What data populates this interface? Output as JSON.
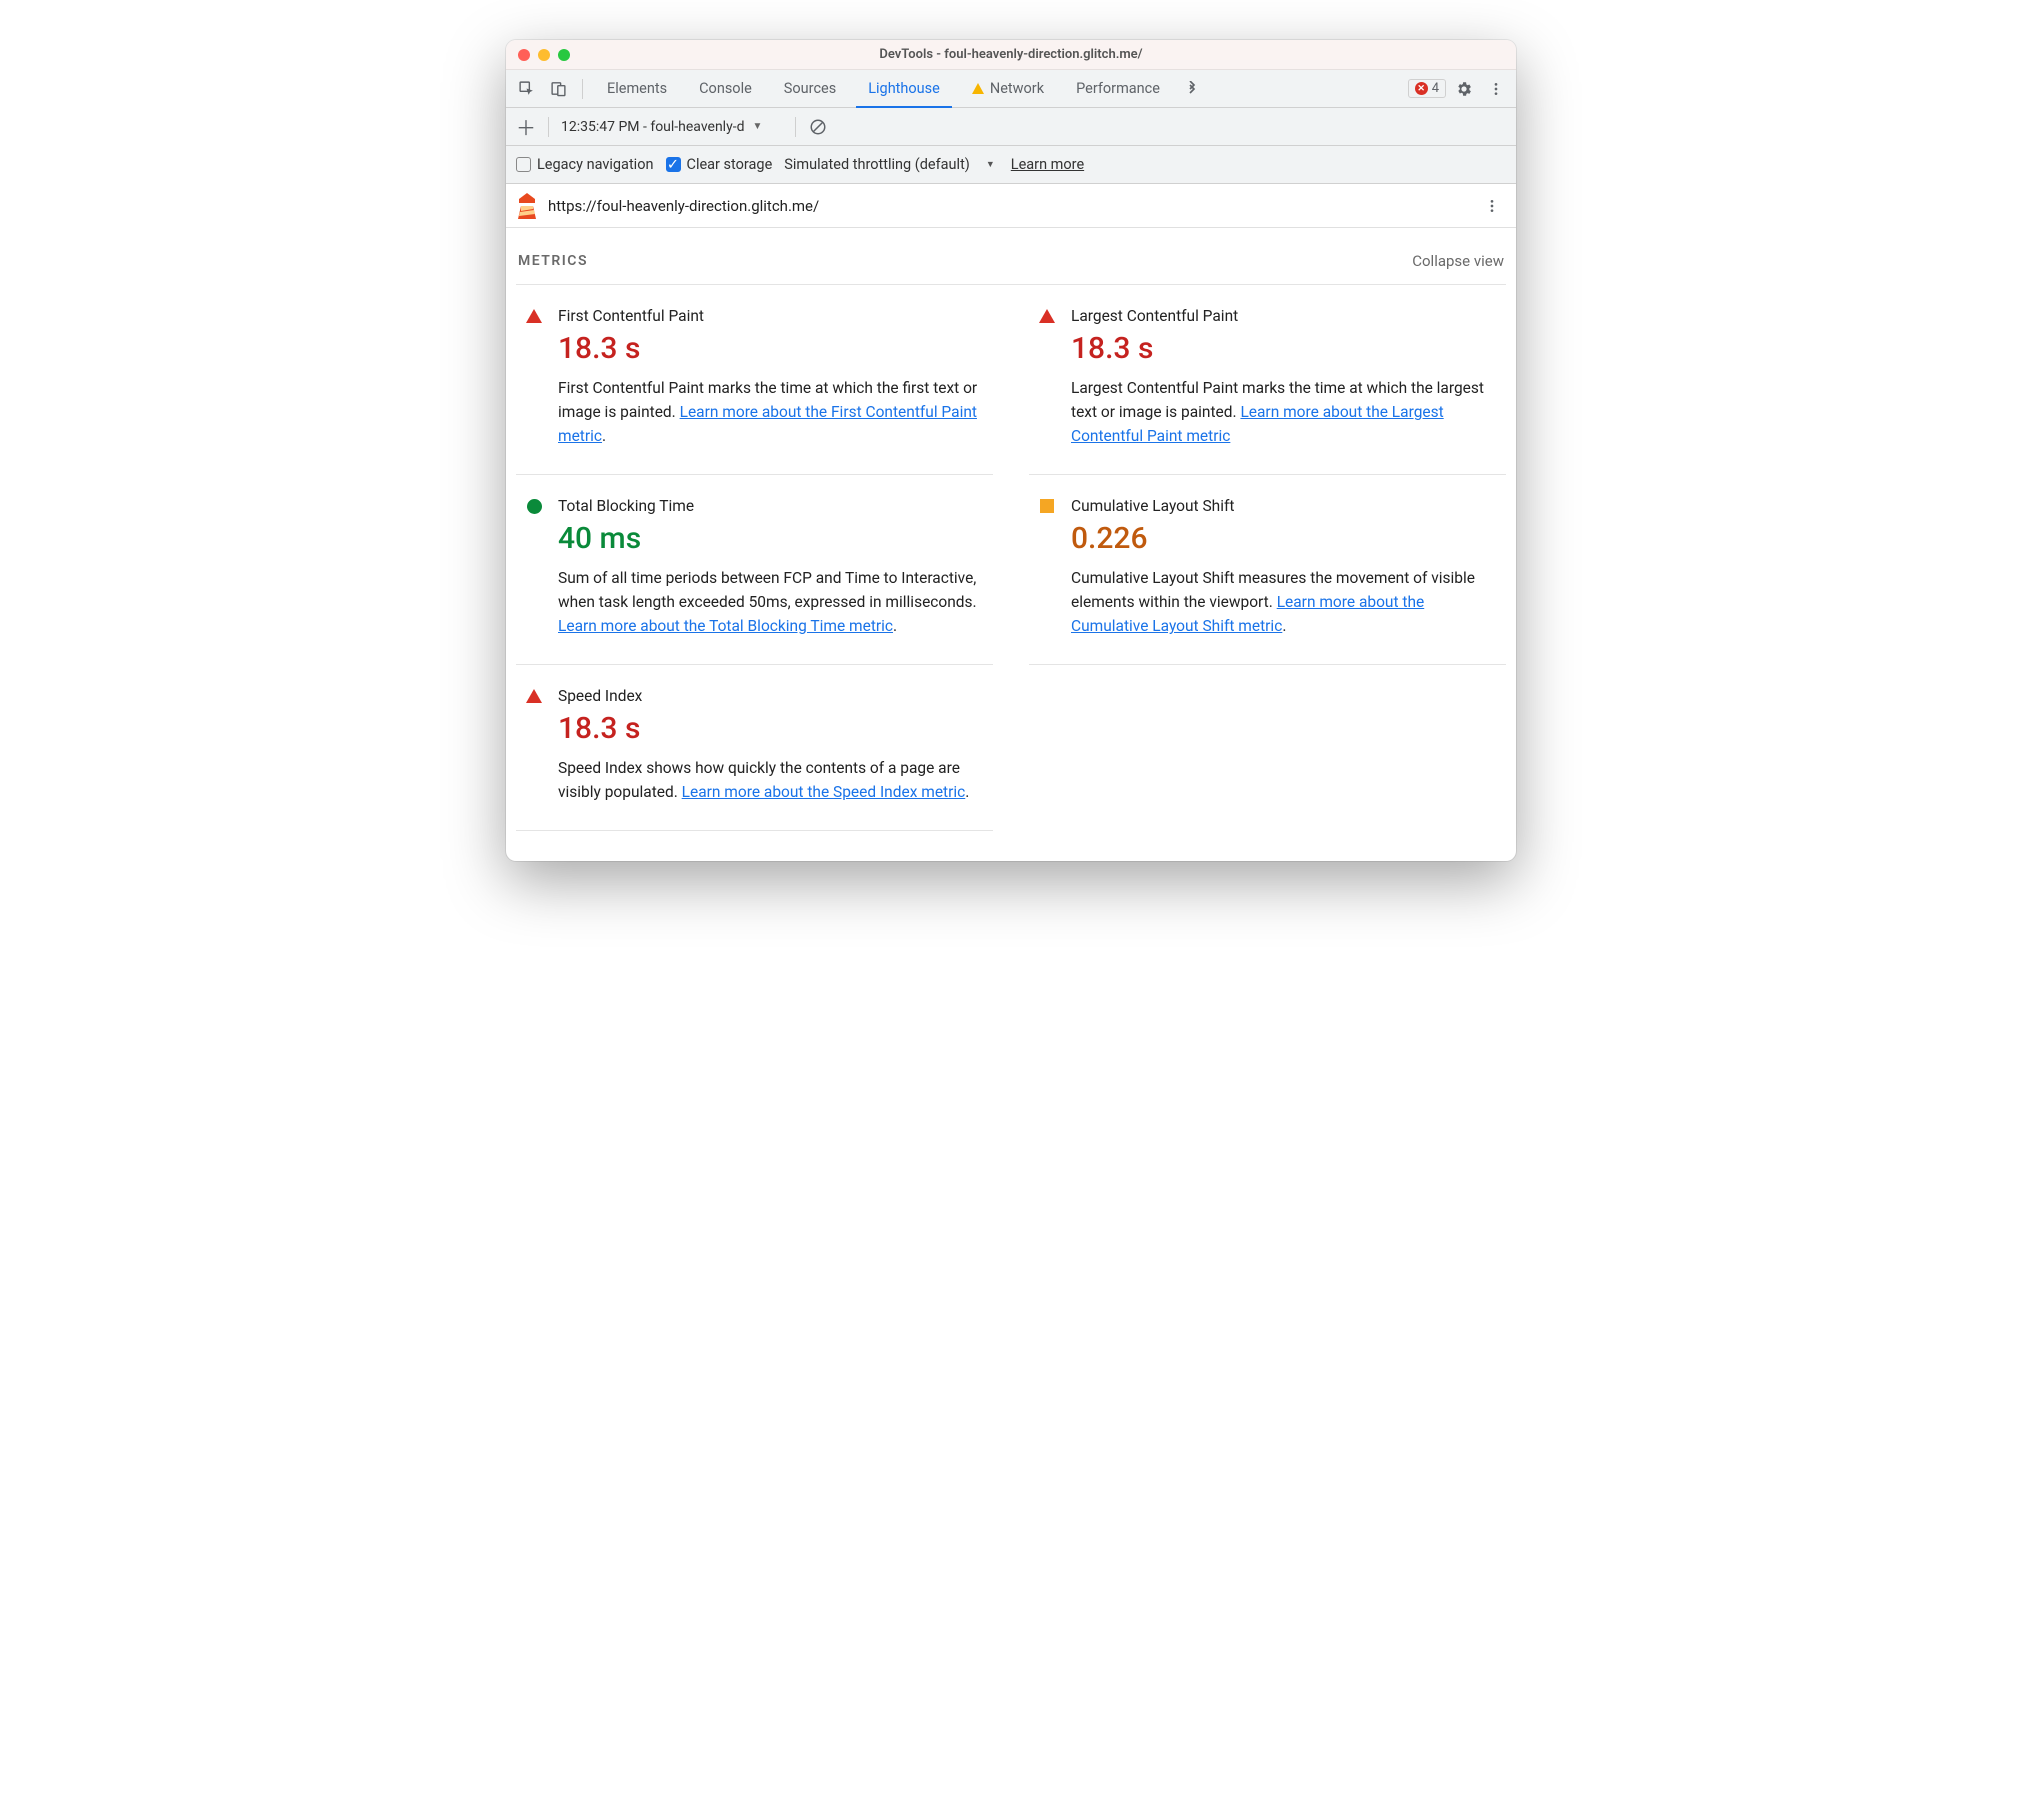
{
  "window": {
    "title": "DevTools - foul-heavenly-direction.glitch.me/"
  },
  "tabs": {
    "items": [
      {
        "label": "Elements"
      },
      {
        "label": "Console"
      },
      {
        "label": "Sources"
      },
      {
        "label": "Lighthouse"
      },
      {
        "label": "Network"
      },
      {
        "label": "Performance"
      }
    ],
    "active_index": 3,
    "error_count": "4"
  },
  "report_toolbar": {
    "timestamp_label": "12:35:47 PM - foul-heavenly-d"
  },
  "options": {
    "legacy_nav_label": "Legacy navigation",
    "legacy_nav_checked": false,
    "clear_storage_label": "Clear storage",
    "clear_storage_checked": true,
    "throttling_label": "Simulated throttling (default)",
    "learn_more_label": "Learn more"
  },
  "url_row": {
    "url": "https://foul-heavenly-direction.glitch.me/"
  },
  "section": {
    "title": "METRICS",
    "collapse_label": "Collapse view"
  },
  "metrics": [
    {
      "name": "First Contentful Paint",
      "value": "18.3 s",
      "status": "fail",
      "desc_pre": "First Contentful Paint marks the time at which the first text or image is painted. ",
      "link_text": "Learn more about the First Contentful Paint metric",
      "desc_post": "."
    },
    {
      "name": "Largest Contentful Paint",
      "value": "18.3 s",
      "status": "fail",
      "desc_pre": "Largest Contentful Paint marks the time at which the largest text or image is painted. ",
      "link_text": "Learn more about the Largest Contentful Paint metric",
      "desc_post": ""
    },
    {
      "name": "Total Blocking Time",
      "value": "40 ms",
      "status": "pass",
      "desc_pre": "Sum of all time periods between FCP and Time to Interactive, when task length exceeded 50ms, expressed in milliseconds. ",
      "link_text": "Learn more about the Total Blocking Time metric",
      "desc_post": "."
    },
    {
      "name": "Cumulative Layout Shift",
      "value": "0.226",
      "status": "avg",
      "desc_pre": "Cumulative Layout Shift measures the movement of visible elements within the viewport. ",
      "link_text": "Learn more about the Cumulative Layout Shift metric",
      "desc_post": "."
    },
    {
      "name": "Speed Index",
      "value": "18.3 s",
      "status": "fail",
      "desc_pre": "Speed Index shows how quickly the contents of a page are visibly populated. ",
      "link_text": "Learn more about the Speed Index metric",
      "desc_post": "."
    }
  ]
}
